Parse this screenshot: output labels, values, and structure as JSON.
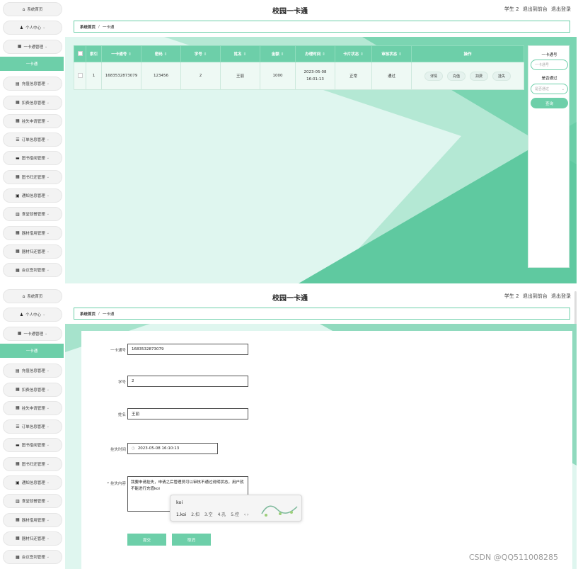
{
  "header": {
    "title": "校园一卡通",
    "user_text": "学生 2",
    "front_link": "退出到前台",
    "logout_link": "退出登录"
  },
  "breadcrumb": {
    "home": "系统首页",
    "separator": "/",
    "current": "一卡通"
  },
  "sidebar": {
    "items": [
      {
        "label": "系统首页",
        "icon": "home-icon",
        "glyph": "⌂"
      },
      {
        "label": "个人中心",
        "icon": "user-icon",
        "glyph": "♟"
      },
      {
        "label": "一卡通管理",
        "icon": "grid-icon",
        "glyph": "▦"
      },
      {
        "label": "一卡通",
        "active": true
      },
      {
        "label": "充值信息管理",
        "icon": "doc-icon",
        "glyph": "▤"
      },
      {
        "label": "扣费信息管理",
        "icon": "grid-icon",
        "glyph": "▦"
      },
      {
        "label": "挂失申请管理",
        "icon": "grid-icon",
        "glyph": "▦"
      },
      {
        "label": "订单信息管理",
        "icon": "list-icon",
        "glyph": "☰"
      },
      {
        "label": "图书借阅管理",
        "icon": "book-icon",
        "glyph": "▬"
      },
      {
        "label": "图书归还管理",
        "icon": "grid-icon",
        "glyph": "▦"
      },
      {
        "label": "通知信息管理",
        "icon": "clipboard-icon",
        "glyph": "▣"
      },
      {
        "label": "食堂就餐管理",
        "icon": "chart-icon",
        "glyph": "▥"
      },
      {
        "label": "器材借用管理",
        "icon": "grid-icon",
        "glyph": "▦"
      },
      {
        "label": "器材归还管理",
        "icon": "grid-icon",
        "glyph": "▦"
      },
      {
        "label": "会议签到管理",
        "icon": "grid-icon",
        "glyph": "▦"
      }
    ]
  },
  "table": {
    "columns": [
      "",
      "索引",
      "一卡通号",
      "密码",
      "学号",
      "姓名",
      "金额",
      "办理时间",
      "卡片状态",
      "审核状态",
      "操作"
    ],
    "sort_glyph": "⇕",
    "rows": [
      {
        "index": "1",
        "card_no": "1683532873079",
        "password": "123456",
        "student_no": "2",
        "name": "王丽",
        "amount": "1000",
        "time": "2023-05-08 16:01:13",
        "card_status": "正常",
        "review_status": "通过",
        "actions": [
          "详情",
          "充值",
          "扣费",
          "挂失"
        ]
      }
    ]
  },
  "filter": {
    "card_label": "一卡通号",
    "card_placeholder": "一卡通号",
    "review_label": "是否通过",
    "review_placeholder": "是否通过",
    "search_button": "查询"
  },
  "form": {
    "card_label": "一卡通号",
    "card_value": "1683532873079",
    "student_label": "学号",
    "student_value": "2",
    "name_label": "姓名",
    "name_value": "王丽",
    "time_label": "挂失时间",
    "time_value": "2023-05-08 16:10:13",
    "reason_label": "* 挂失内容",
    "reason_value": "我要申请挂失，申请之后管理员可以审核不通过说明状态，用户就不能进行充值koi",
    "submit": "提交",
    "cancel": "取消"
  },
  "ime": {
    "typed": "koi",
    "candidates": [
      "1.koi",
      "2.扣",
      "3.空",
      "4.孔",
      "5.控"
    ],
    "arrow": "‹ ›"
  },
  "watermark": "CSDN @QQ511008285",
  "colors": {
    "accent": "#6dcfa9",
    "accent_light": "#dff6ef"
  }
}
